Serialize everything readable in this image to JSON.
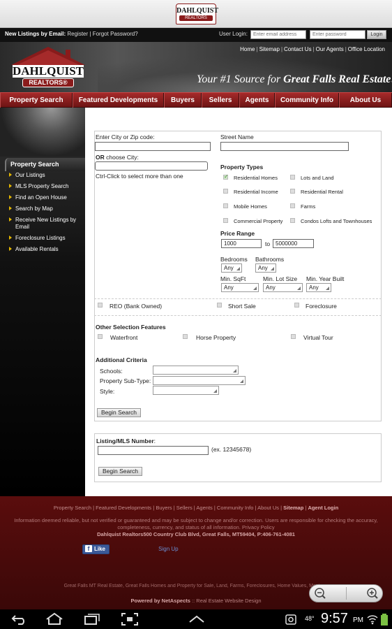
{
  "top_logo": {
    "line1": "DAHLQUIST",
    "line2": "REALTORS"
  },
  "login_bar": {
    "new_listings_label": "New Listings by Email:",
    "register": "Register",
    "separator": "|",
    "forgot": "Forgot Password?",
    "user_login_label": "User Login:",
    "email_placeholder": "Enter email address",
    "password_placeholder": "Enter password",
    "login_button": "Login"
  },
  "header": {
    "logo_name": "DAHLQUIST",
    "logo_sub": "REALTORS®",
    "links": [
      "Home",
      "Sitemap",
      "Contact Us",
      "Our Agents",
      "Office Location"
    ],
    "tagline_a": "Your #1 Source for ",
    "tagline_b": "Great Falls Real Estate!"
  },
  "nav": [
    "Property Search",
    "Featured Developments",
    "Buyers",
    "Sellers",
    "Agents",
    "Community Info",
    "About Us"
  ],
  "sidebar": {
    "heading": "Property Search",
    "items": [
      "Our Listings",
      "MLS Property Search",
      "Find an Open House",
      "Search by Map",
      "Receive New Listings by Email",
      "Foreclosure Listings",
      "Available Rentals"
    ]
  },
  "form": {
    "city_zip_label": "Enter City or Zip code:",
    "city_zip_value": "",
    "or_label": "OR",
    "choose_city_label": " choose City:",
    "ctrl_click_hint": "Ctrl-Click to select more than one",
    "street_label": "Street Name",
    "street_value": "",
    "property_types_label": "Property Types",
    "property_types": [
      {
        "label": "Residential Homes",
        "checked": true
      },
      {
        "label": "Lots and Land",
        "checked": false
      },
      {
        "label": "Residential Income",
        "checked": false
      },
      {
        "label": "Residential Rental",
        "checked": false
      },
      {
        "label": "Mobile Homes",
        "checked": false
      },
      {
        "label": "Farms",
        "checked": false
      },
      {
        "label": "Commercial Property",
        "checked": false
      },
      {
        "label": "Condos Lofts and Townhouses",
        "checked": false
      }
    ],
    "price_range_label": "Price Range",
    "price_min": "1000",
    "price_to": "to",
    "price_max": "5000000",
    "bedrooms_label": "Bedrooms",
    "bedrooms_value": "Any",
    "bathrooms_label": "Bathrooms",
    "bathrooms_value": "Any",
    "min_sqft_label": "Min. SqFt",
    "min_sqft_value": "Any",
    "min_lot_label": "Min. Lot Size",
    "min_lot_value": "Any",
    "min_year_label": "Min. Year Built",
    "min_year_value": "Any",
    "sale_types": [
      {
        "label": "REO (Bank Owned)",
        "checked": false
      },
      {
        "label": "Short Sale",
        "checked": false
      },
      {
        "label": "Foreclosure",
        "checked": false
      }
    ],
    "other_features_label": "Other Selection Features",
    "other_features": [
      {
        "label": "Waterfront",
        "checked": false
      },
      {
        "label": "Horse Property",
        "checked": false
      },
      {
        "label": "Virtual Tour",
        "checked": false
      }
    ],
    "additional_label": "Additional Criteria",
    "schools_label": "Schools:",
    "subtype_label": "Property Sub-Type:",
    "style_label": "Style:",
    "begin_search": "Begin Search"
  },
  "mls_form": {
    "label": "Listing/MLS Number",
    "colon": ":",
    "value": "",
    "example": "(ex. 12345678)",
    "begin_search": "Begin Search"
  },
  "footer": {
    "links": [
      "Property Search",
      "Featured Developments",
      "Buyers",
      "Sellers",
      "Agents",
      "Community Info",
      "About Us",
      "Sitemap",
      "Agent Login"
    ],
    "disclaimer": "Information deemed reliable, but not verified or guaranteed and may be subject to change and/or correction. Users are responsible for checking the accuracy, completeness, currency, and status of all information. Privacy Policy",
    "address": "Dahlquist Realtors500 Country Club Blvd, Great Falls, MT59404, P:406-761-4081",
    "fb_like": "Like",
    "fb_signup": "Sign Up",
    "seo": "Great Falls MT Real Estate, Great Falls Homes and Property for Sale, Land, Farms, Foreclosures, Home Values, Montana",
    "powered_a": "Powered by NetAspects",
    "powered_b": " :: Real Estate Website Design"
  },
  "status_bar": {
    "temp": "48°",
    "time": "9:57",
    "ampm": "PM"
  },
  "colors": {
    "brand": "#8a1b1b",
    "nav": "#7a1818",
    "footer": "#4a0a0a"
  }
}
